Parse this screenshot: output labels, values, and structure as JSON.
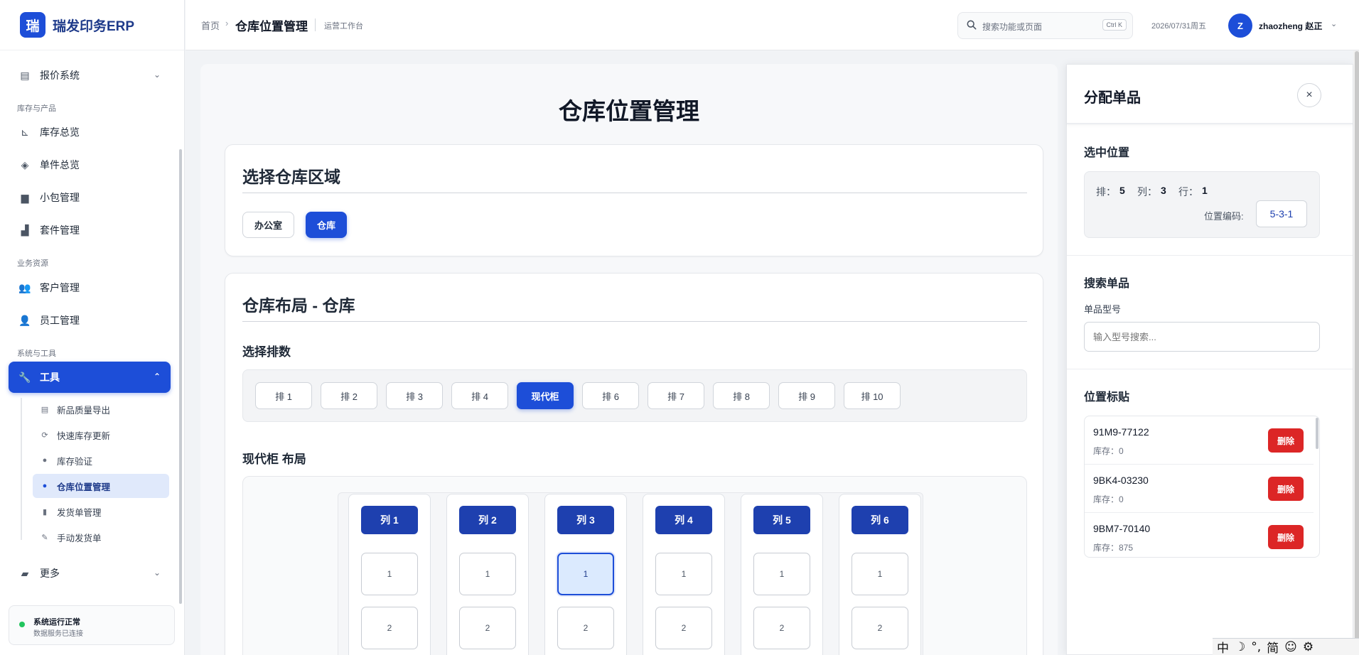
{
  "brand": {
    "logo_char": "瑞",
    "name": "瑞发印务ERP"
  },
  "sidebar": {
    "quote_system": "报价系统",
    "section_inventory": "库存与产品",
    "inventory_overview": "库存总览",
    "unit_overview": "单件总览",
    "package_management": "小包管理",
    "kit_management": "套件管理",
    "section_business": "业务资源",
    "customer_management": "客户管理",
    "employee_management": "员工管理",
    "section_tools": "系统与工具",
    "tools": "工具",
    "sub_items": [
      {
        "label": "新品质量导出",
        "icon": "export-icon"
      },
      {
        "label": "快速库存更新",
        "icon": "refresh-icon"
      },
      {
        "label": "库存验证",
        "icon": "check-circle-icon"
      },
      {
        "label": "仓库位置管理",
        "icon": "map-pin-icon"
      },
      {
        "label": "发货单管理",
        "icon": "document-icon"
      },
      {
        "label": "手动发货单",
        "icon": "edit-icon"
      }
    ],
    "more": "更多",
    "status_title": "系统运行正常",
    "status_sub": "数据服务已连接",
    "status_color": "#22c55e"
  },
  "header": {
    "crumb_home": "首页",
    "crumb_current": "仓库位置管理",
    "crumb_tag": "运营工作台",
    "search_placeholder": "搜索功能或页面",
    "search_shortcut": "Ctrl K",
    "date": "2026/07/31周五",
    "avatar_initial": "Z",
    "user_name": "zhaozheng 赵正"
  },
  "main": {
    "page_title": "仓库位置管理",
    "area_card_title": "选择仓库区域",
    "areas": [
      {
        "label": "办公室",
        "active": false
      },
      {
        "label": "仓库",
        "active": true
      }
    ],
    "layout_card_title": "仓库布局 - 仓库",
    "row_select_title": "选择排数",
    "rows": [
      "排 1",
      "排 2",
      "排 3",
      "排 4",
      "现代柜",
      "排 6",
      "排 7",
      "排 8",
      "排 9",
      "排 10"
    ],
    "active_row_index": 4,
    "layout_title": "现代柜 布局",
    "columns": [
      "列 1",
      "列 2",
      "列 3",
      "列 4",
      "列 5",
      "列 6"
    ],
    "cells": [
      "1",
      "2"
    ],
    "selected": {
      "column_index": 2,
      "cell_index": 0
    }
  },
  "drawer": {
    "title": "分配单品",
    "close_label": "×",
    "selected_section": "选中位置",
    "row_label": "排：",
    "row_value": "5",
    "col_label": "列：",
    "col_value": "3",
    "line_label": "行：",
    "line_value": "1",
    "code_label": "位置编码:",
    "code_value": "5-3-1",
    "search_section": "搜索单品",
    "field_label": "单品型号",
    "field_placeholder": "输入型号搜索...",
    "tags_section": "位置标贴",
    "tags": [
      {
        "code": "91M9-77122",
        "stock": "库存：0",
        "delete": "删除"
      },
      {
        "code": "9BK4-03230",
        "stock": "库存：0",
        "delete": "删除"
      },
      {
        "code": "9BM7-70140",
        "stock": "库存：875",
        "delete": "删除"
      }
    ]
  },
  "ime": [
    "中",
    "☽",
    "°,",
    "简",
    "☺",
    "⚙"
  ],
  "colors": {
    "primary": "#1d4ed8",
    "column_header": "#1e40af",
    "danger": "#dc2626"
  }
}
